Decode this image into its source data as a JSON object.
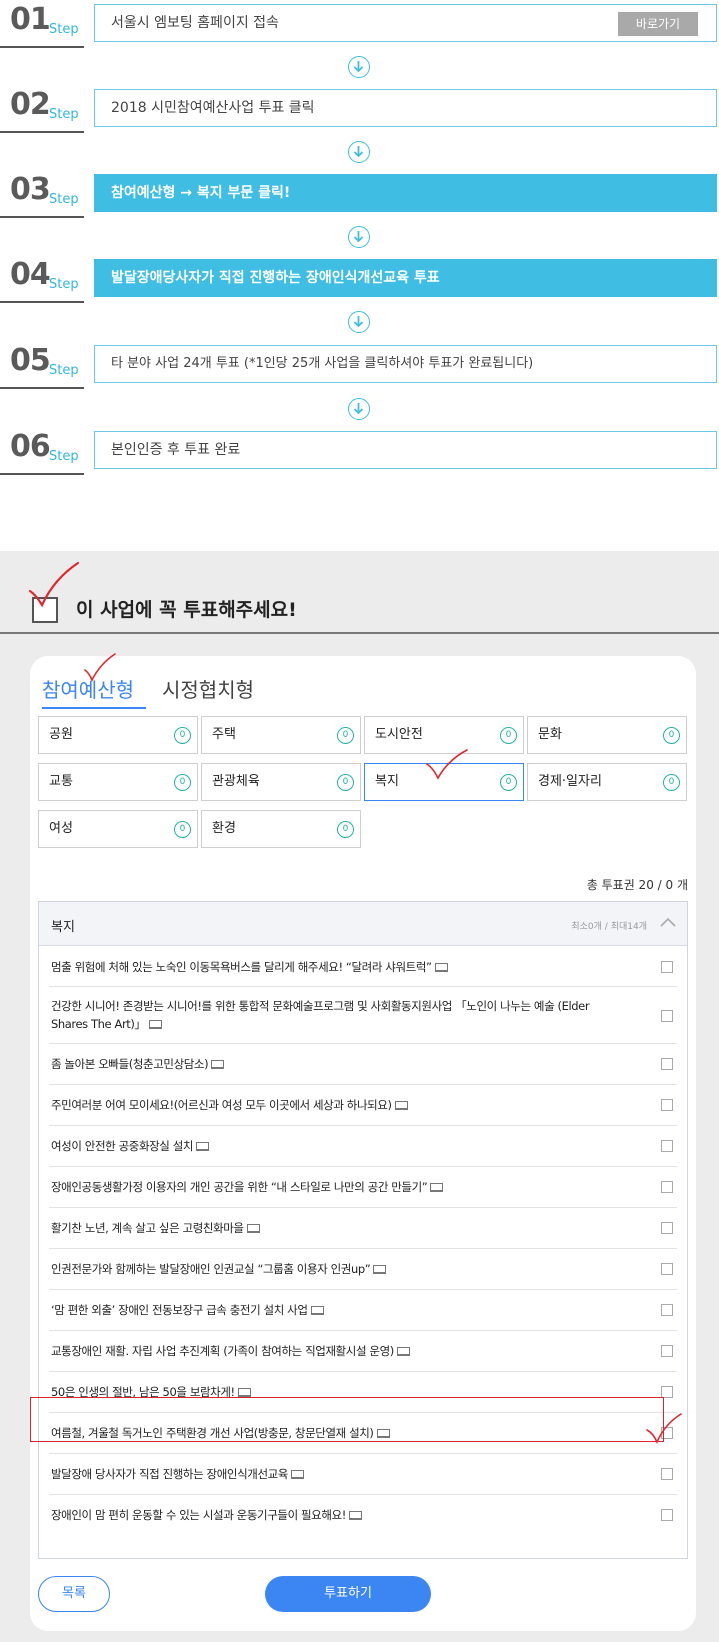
{
  "step_word": "Step",
  "steps": [
    {
      "num": "01",
      "text": "서울시 엠보팅 홈페이지 접속",
      "button": "바로가기"
    },
    {
      "num": "02",
      "text": "2018 시민참여예산사업 투표 클릭"
    },
    {
      "num": "03",
      "text": "참여예산형 → 복지 부문 클릭!"
    },
    {
      "num": "04",
      "text": "발달장애당사자가 직접 진행하는 장애인식개선교육 투표"
    },
    {
      "num": "05",
      "text": "타 분야 사업 24개 투표 (*1인당 25개 사업을 클릭하셔야 투표가 완료됩니다)"
    },
    {
      "num": "06",
      "text": "본인인증 후 투표 완료"
    }
  ],
  "vote": {
    "title": "이 사업에 꼭 투표해주세요!",
    "tabs": [
      "참여예산형",
      "시정협치형"
    ],
    "categories": [
      {
        "label": "공원",
        "count": "0"
      },
      {
        "label": "주택",
        "count": "0"
      },
      {
        "label": "도시안전",
        "count": "0"
      },
      {
        "label": "문화",
        "count": "0"
      },
      {
        "label": "교통",
        "count": "0"
      },
      {
        "label": "관광체육",
        "count": "0"
      },
      {
        "label": "복지",
        "count": "0"
      },
      {
        "label": "경제·일자리",
        "count": "0"
      },
      {
        "label": "여성",
        "count": "0"
      },
      {
        "label": "환경",
        "count": "0"
      }
    ],
    "total": "총 투표권 20 / 0 개",
    "list_title": "복지",
    "list_limit": "최소0개 / 최대14개",
    "items": [
      "멈출 위험에 처해 있는 노숙인 이동목욕버스를 달리게 해주세요! “달려라 샤워트럭”",
      "건강한 시니어! 존경받는 시니어!를 위한 통합적 문화예술프로그램 및 사회활동지원사업 「노인이 나누는 예술 (Elder Shares The Art)」",
      "좀 놀아본 오빠들(청춘고민상담소)",
      "주민여러분 어여 모이세요!(어르신과 여성 모두 이곳에서 세상과 하나되요)",
      "여성이 안전한 공중화장실 설치",
      "장애인공동생활가정 이용자의 개인 공간을 위한 “내 스타일로 나만의 공간 만들기”",
      "활기찬 노년, 계속 살고 싶은 고령친화마을",
      "인권전문가와 함께하는 발달장애인 인권교실 “그룹홈 이용자 인권up”",
      "‘맘 편한 외출’ 장애인 전동보장구 급속 충전기 설치 사업",
      "교통장애인 재활. 자립 사업 추진계획 (가족이 참여하는 직업재활시설 운영)",
      "50은 인생의 절반, 남은 50을 보람차게!",
      "여름철, 겨울철 독거노인 주택환경 개선 사업(방충문, 창문단열재 설치)",
      "발달장애 당사자가 직접 진행하는 장애인식개선교육",
      "장애인이 맘 편히 운동할 수 있는 시설과 운동기구들이 필요해요!"
    ],
    "btn_list": "목록",
    "btn_vote": "투표하기"
  }
}
